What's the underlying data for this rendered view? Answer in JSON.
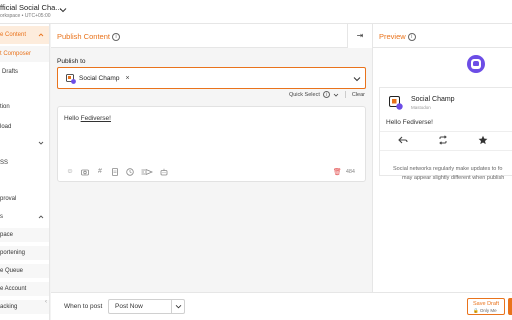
{
  "colors": {
    "accent": "#e9731c",
    "active_bg": "#fdecdc",
    "mastodon": "#6c4de6",
    "danger": "#e35050"
  },
  "workspace": {
    "name": "fficial Social Cha...",
    "subtitle": "orkspace • UTC+05:00"
  },
  "sidebar": {
    "items": [
      {
        "label": "e Content",
        "state": "active",
        "caret": "up"
      },
      {
        "label": "t Composer",
        "state": "sub-active"
      },
      {
        "label": "Drafts",
        "state": "normal"
      },
      {
        "label": "tion",
        "state": "normal"
      },
      {
        "label": "load",
        "state": "normal"
      },
      {
        "label": "",
        "state": "normal",
        "caret": "down"
      },
      {
        "label": "SS",
        "state": "normal"
      },
      {
        "label": "proval",
        "state": "normal"
      },
      {
        "label": "s",
        "state": "normal",
        "caret": "up"
      },
      {
        "label": "pace",
        "state": "normal"
      },
      {
        "label": "portening",
        "state": "normal"
      },
      {
        "label": "e Queue",
        "state": "normal"
      },
      {
        "label": "e Account",
        "state": "normal"
      },
      {
        "label": "acking",
        "state": "normal"
      }
    ],
    "collapse_glyph": "‹"
  },
  "publish": {
    "title": "Publish Content",
    "publish_to_label": "Publish to",
    "selected_account": "Social Champ",
    "quick_select": "Quick Select",
    "clear": "Clear",
    "collapse_glyph": "⇥"
  },
  "editor": {
    "text_prefix": "Hello ",
    "text_link": "Fediverse!",
    "char_count": "484",
    "toolbar_icons": [
      "emoji-icon",
      "camera-icon",
      "hashtag-icon",
      "document-icon",
      "clock-icon",
      "video-icon",
      "robot-icon"
    ]
  },
  "bottom": {
    "when_label": "When to post",
    "when_value": "Post Now",
    "save_draft": "Save Draft",
    "only_me": "Only Me"
  },
  "preview": {
    "title": "Preview",
    "network_icon": "mastodon-icon",
    "account_name": "Social Champ",
    "handle": "Mastodon",
    "post_text": "Hello Fediverse!",
    "note_line1": "Social networks regularly make updates to fo",
    "note_line2": "may appear slightly different when publish"
  }
}
